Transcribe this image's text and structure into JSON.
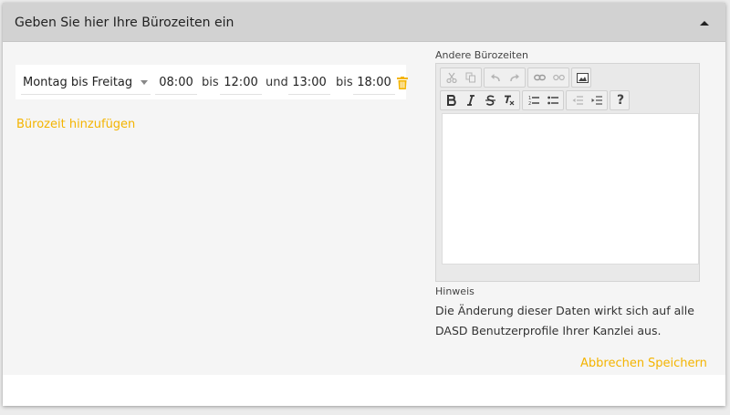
{
  "panel": {
    "title": "Geben Sie hier Ihre Bürozeiten ein"
  },
  "office_hours_row": {
    "days": "Montag bis Freitag",
    "from1": "08:00",
    "sep1": "bis",
    "to1": "12:00",
    "join": "und",
    "from2": "13:00",
    "sep2": "bis",
    "to2": "18:00"
  },
  "add_office_hours_label": "Bürozeit hinzufügen",
  "other_hours": {
    "label": "Andere Bürozeiten",
    "editor_value": ""
  },
  "toolbar": {
    "help_glyph": "?"
  },
  "hint": {
    "label": "Hinweis",
    "text": "Die Änderung dieser Daten wirkt sich auf alle DASD Benutzerprofile Ihrer Kanzlei aus."
  },
  "actions": {
    "cancel": "Abbrechen",
    "save": "Speichern"
  },
  "colors": {
    "accent": "#f4b400",
    "header_bg": "#d2d2d2",
    "panel_bg": "#f5f5f5"
  },
  "icons": [
    "chevron-up-icon",
    "trash-icon",
    "cut-icon",
    "copy-icon",
    "undo-icon",
    "redo-icon",
    "link-icon",
    "unlink-icon",
    "image-icon",
    "bold-icon",
    "italic-icon",
    "strikethrough-icon",
    "clear-format-icon",
    "numbered-list-icon",
    "bulleted-list-icon",
    "outdent-icon",
    "indent-icon",
    "help-icon"
  ]
}
